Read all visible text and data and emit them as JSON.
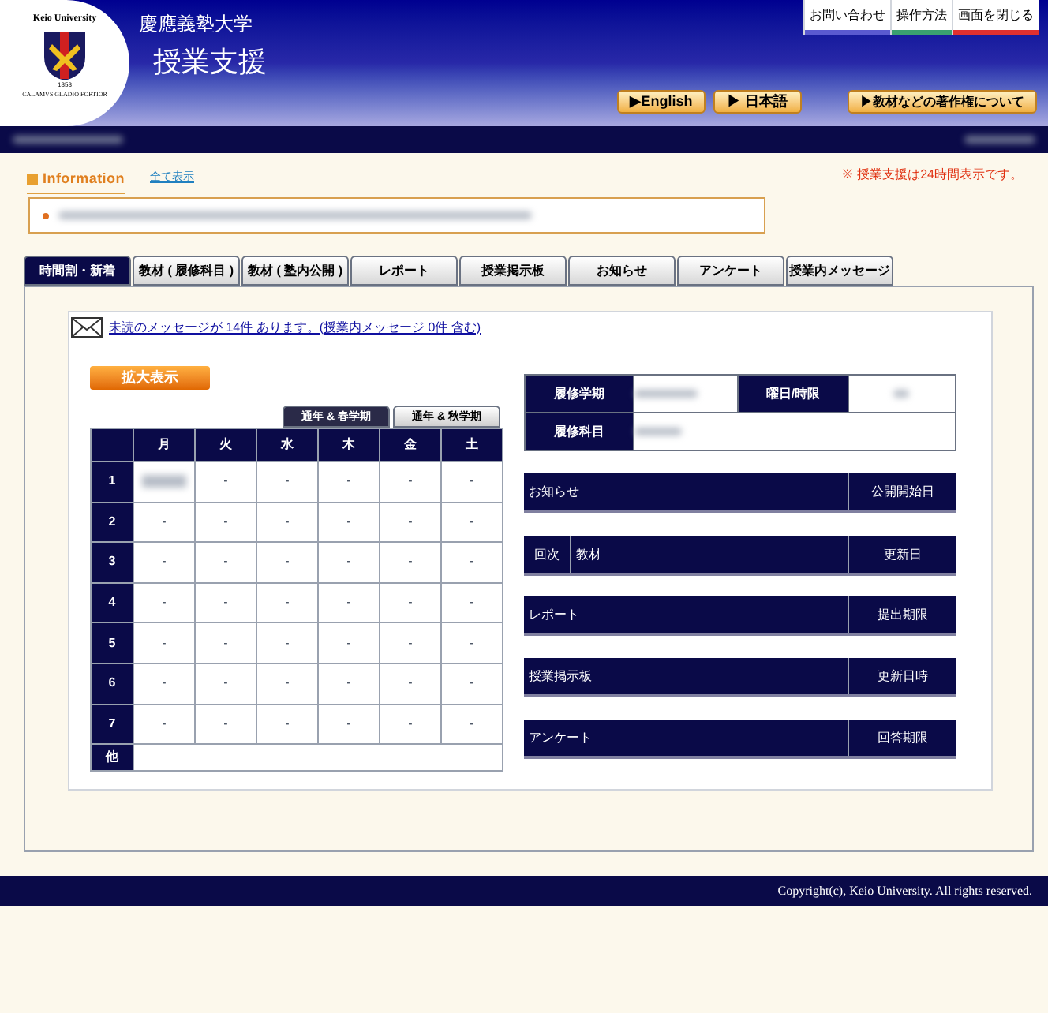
{
  "logo": {
    "top": "Keio University",
    "year": "1858",
    "motto": "CALAMVS GLADIO FORTIOR"
  },
  "header": {
    "university": "慶應義塾大学",
    "title": "授業支援"
  },
  "top_links": [
    {
      "label": "お問い合わせ",
      "color": "#5a5ad0"
    },
    {
      "label": "操作方法",
      "color": "#3aa070"
    },
    {
      "label": "画面を閉じる",
      "color": "#e03030"
    }
  ],
  "lang_buttons": [
    "▶English",
    "▶ 日本語"
  ],
  "copyright_button": "▶教材などの著作権について",
  "information": {
    "title": "Information",
    "show_all": "全て表示",
    "notice": "※ 授業支援は24時間表示です。"
  },
  "tabs": [
    {
      "label": "時間割・新着",
      "selected": true
    },
    {
      "label": "教材 ( 履修科目 )",
      "selected": false
    },
    {
      "label": "教材 ( 塾内公開 )",
      "selected": false
    },
    {
      "label": "レポート",
      "selected": false
    },
    {
      "label": "授業掲示板",
      "selected": false
    },
    {
      "label": "お知らせ",
      "selected": false
    },
    {
      "label": "アンケート",
      "selected": false
    },
    {
      "label": "授業内メッセージ",
      "selected": false
    }
  ],
  "message_link": "未読のメッセージが 14件 あります。(授業内メッセージ 0件 含む)",
  "zoom_button": "拡大表示",
  "term_tabs": [
    {
      "label": "通年 & 春学期",
      "selected": true
    },
    {
      "label": "通年 & 秋学期",
      "selected": false
    }
  ],
  "timetable": {
    "days": [
      "月",
      "火",
      "水",
      "木",
      "金",
      "土"
    ],
    "rows": [
      {
        "period": "1",
        "cells": [
          "",
          "-",
          "-",
          "-",
          "-",
          "-"
        ]
      },
      {
        "period": "2",
        "cells": [
          "-",
          "-",
          "-",
          "-",
          "-",
          "-"
        ]
      },
      {
        "period": "3",
        "cells": [
          "-",
          "-",
          "-",
          "-",
          "-",
          "-"
        ]
      },
      {
        "period": "4",
        "cells": [
          "-",
          "-",
          "-",
          "-",
          "-",
          "-"
        ]
      },
      {
        "period": "5",
        "cells": [
          "-",
          "-",
          "-",
          "-",
          "-",
          "-"
        ]
      },
      {
        "period": "6",
        "cells": [
          "-",
          "-",
          "-",
          "-",
          "-",
          "-"
        ]
      },
      {
        "period": "7",
        "cells": [
          "-",
          "-",
          "-",
          "-",
          "-",
          "-"
        ]
      }
    ],
    "other": "他"
  },
  "course_info": {
    "term_label": "履修学期",
    "day_label": "曜日/時限",
    "subject_label": "履修科目"
  },
  "sections": [
    {
      "title": "お知らせ",
      "date_label": "公開開始日"
    },
    {
      "number_label": "回次",
      "title": "教材",
      "date_label": "更新日"
    },
    {
      "title": "レポート",
      "date_label": "提出期限"
    },
    {
      "title": "授業掲示板",
      "date_label": "更新日時"
    },
    {
      "title": "アンケート",
      "date_label": "回答期限"
    }
  ],
  "footer": "Copyright(c), Keio University. All rights reserved."
}
